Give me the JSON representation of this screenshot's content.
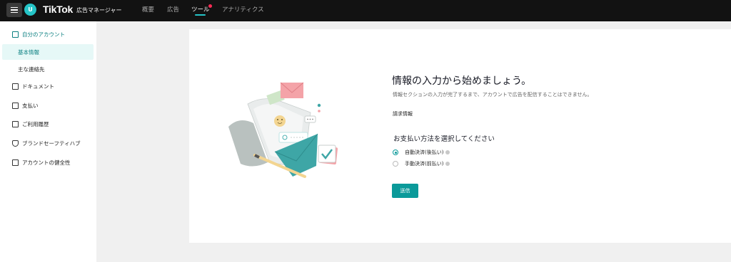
{
  "header": {
    "avatar_letter": "U",
    "brand": "TikTok",
    "brand_sub": "広告マネージャー",
    "nav": [
      {
        "label": "概要"
      },
      {
        "label": "広告"
      },
      {
        "label": "ツール"
      },
      {
        "label": "アナリティクス"
      }
    ],
    "active_nav": "ツール"
  },
  "sidebar": {
    "section": "自分のアカウント",
    "sub_items": [
      {
        "label": "基本情報"
      },
      {
        "label": "主な連絡先"
      }
    ],
    "items": [
      {
        "label": "ドキュメント",
        "icon": "document-icon"
      },
      {
        "label": "支払い",
        "icon": "wallet-icon"
      },
      {
        "label": "ご利用履歴",
        "icon": "history-icon"
      },
      {
        "label": "ブランドセーフティハブ",
        "icon": "shield-icon"
      },
      {
        "label": "アカウントの健全性",
        "icon": "health-icon"
      }
    ]
  },
  "main": {
    "title": "情報の入力から始めましょう。",
    "subtitle": "情報セクションの入力が完了するまで、アカウントで広告を配信することはできません。",
    "billing_label": "請求情報",
    "payment_title": "お支払い方法を選択してください",
    "options": [
      {
        "label": "自動決済(後払い)",
        "checked": true
      },
      {
        "label": "手動決済(前払い)",
        "checked": false
      }
    ],
    "submit": "送信"
  },
  "colors": {
    "accent": "#0b9a9a",
    "topbar": "#121212",
    "notification": "#fe2c55"
  }
}
